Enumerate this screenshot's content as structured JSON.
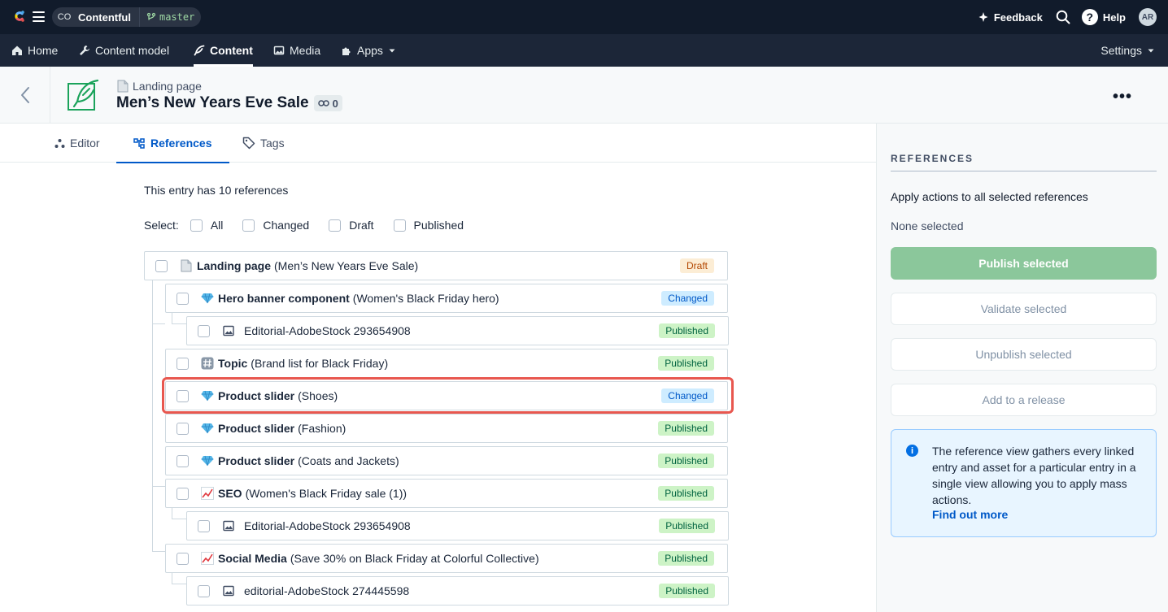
{
  "topbar": {
    "space_initials": "CO",
    "space_name": "Contentful",
    "environment": "master",
    "feedback": "Feedback",
    "help": "Help",
    "user_initials": "AR"
  },
  "nav": {
    "home": "Home",
    "content_model": "Content model",
    "content": "Content",
    "media": "Media",
    "apps": "Apps",
    "settings": "Settings"
  },
  "entry": {
    "content_type": "Landing page",
    "title": "Men’s New Years Eve Sale",
    "link_count": "0"
  },
  "tabs": {
    "editor": "Editor",
    "references": "References",
    "tags": "Tags"
  },
  "main": {
    "ref_count_text": "This entry has 10 references",
    "select_label": "Select:",
    "select_options": [
      "All",
      "Changed",
      "Draft",
      "Published"
    ],
    "rows": [
      {
        "icon": "page-icon",
        "name": "Landing page",
        "desc": "(Men’s New Years Eve Sale)",
        "status": "Draft"
      },
      {
        "icon": "gem-icon",
        "name": "Hero banner component",
        "desc": "(Women's Black Friday hero)",
        "status": "Changed"
      },
      {
        "icon": "image-icon",
        "name": "",
        "desc": "Editorial-AdobeStock 293654908",
        "status": "Published"
      },
      {
        "icon": "hash-icon",
        "name": "Topic",
        "desc": "(Brand list for Black Friday)",
        "status": "Published"
      },
      {
        "icon": "gem-icon",
        "name": "Product slider",
        "desc": "(Shoes)",
        "status": "Changed"
      },
      {
        "icon": "gem-icon",
        "name": "Product slider",
        "desc": "(Fashion)",
        "status": "Published"
      },
      {
        "icon": "gem-icon",
        "name": "Product slider",
        "desc": "(Coats and Jackets)",
        "status": "Published"
      },
      {
        "icon": "chart-icon",
        "name": "SEO",
        "desc": "(Women's Black Friday sale (1))",
        "status": "Published"
      },
      {
        "icon": "image-icon",
        "name": "",
        "desc": "Editorial-AdobeStock 293654908",
        "status": "Published"
      },
      {
        "icon": "chart-icon",
        "name": "Social Media",
        "desc": "(Save 30% on Black Friday at Colorful Collective)",
        "status": "Published"
      },
      {
        "icon": "image-icon",
        "name": "",
        "desc": "editorial-AdobeStock 274445598",
        "status": "Published"
      }
    ]
  },
  "sidebar": {
    "heading": "REFERENCES",
    "apply_text": "Apply actions to all selected references",
    "none_selected": "None selected",
    "publish": "Publish selected",
    "validate": "Validate selected",
    "unpublish": "Unpublish selected",
    "add_release": "Add to a release",
    "info_text": "The reference view gathers every linked entry and asset for a particular entry in a single view allowing you to apply mass actions.",
    "info_link": "Find out more"
  },
  "colors": {
    "topbar": "#111b2b",
    "navbar": "#1c2638",
    "accent_blue": "#0059c8",
    "publish_green": "#8bc79b",
    "highlight_red": "#e8574f"
  }
}
